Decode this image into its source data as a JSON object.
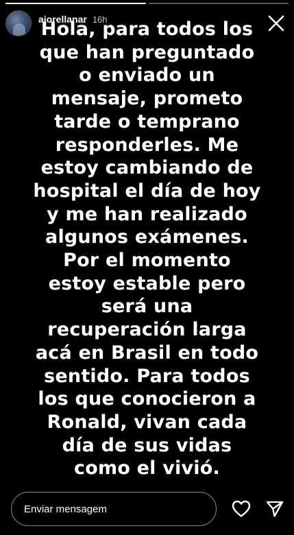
{
  "progress": {
    "segments": [
      {
        "fill_fraction": 1.0
      },
      {
        "fill_fraction": 0.0
      }
    ]
  },
  "header": {
    "username": "ajorellanar",
    "time": "16h",
    "close_icon": "close-icon"
  },
  "story": {
    "text": "Hola, para todos los\nque han preguntado\no enviado un\nmensaje, prometo\ntarde o temprano\nresponderles. Me\nestoy cambiando de\nhospital el día de hoy\ny me han realizado\nalgunos exámenes.\nPor el momento\nestoy estable pero\nserá una\nrecuperación larga\nacá en Brasil en todo\nsentido. Para todos\nlos que conocieron a\nRonald, vivan cada\ndía de sus vidas\ncomo el vivió."
  },
  "footer": {
    "message_placeholder": "Enviar mensagem",
    "message_value": "",
    "like_icon": "heart-icon",
    "send_icon": "paper-plane-icon"
  },
  "colors": {
    "background": "#000000",
    "text": "#ffffff",
    "progress_track": "rgba(255,255,255,0.35)"
  }
}
